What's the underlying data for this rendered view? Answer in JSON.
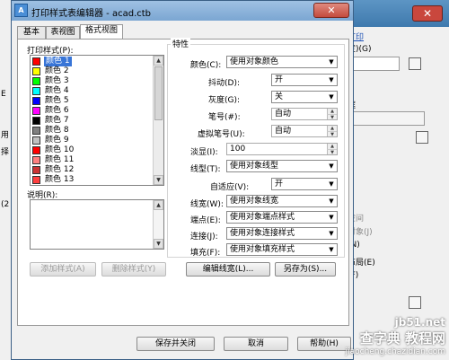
{
  "dialog": {
    "title": "打印样式表编辑器 - acad.ctb",
    "app_icon": "A",
    "close_glyph": "✕",
    "tabs": [
      {
        "label": "基本"
      },
      {
        "label": "表视图"
      },
      {
        "label": "格式视图"
      }
    ]
  },
  "styles": {
    "label": "打印样式(P):",
    "items": [
      {
        "label": "颜色 1",
        "color": "#ff0000",
        "selected": true
      },
      {
        "label": "颜色 2",
        "color": "#ffff00"
      },
      {
        "label": "颜色 3",
        "color": "#00ff00"
      },
      {
        "label": "颜色 4",
        "color": "#00ffff"
      },
      {
        "label": "颜色 5",
        "color": "#0000ff"
      },
      {
        "label": "颜色 6",
        "color": "#ff00ff"
      },
      {
        "label": "颜色 7",
        "color": "#000000"
      },
      {
        "label": "颜色 8",
        "color": "#808080"
      },
      {
        "label": "颜色 9",
        "color": "#c0c0c0"
      },
      {
        "label": "颜色 10",
        "color": "#ff0000"
      },
      {
        "label": "颜色 11",
        "color": "#ff7f7f"
      },
      {
        "label": "颜色 12",
        "color": "#cc3333"
      },
      {
        "label": "颜色 13",
        "color": "#ff3f3f"
      }
    ]
  },
  "description": {
    "label": "说明(R):"
  },
  "buttons": {
    "add_style": "添加样式(A)",
    "delete_style": "删除样式(Y)",
    "edit_lineweights": "编辑线宽(L)...",
    "save_as": "另存为(S)...",
    "save_close": "保存并关闭",
    "cancel": "取消",
    "help": "帮助(H)"
  },
  "properties": {
    "title": "特性",
    "color": {
      "label": "颜色(C):",
      "value": "使用对象颜色"
    },
    "dither": {
      "label": "抖动(D):",
      "value": "开"
    },
    "grayscale": {
      "label": "灰度(G):",
      "value": "关"
    },
    "pen": {
      "label": "笔号(#):",
      "value": "自动"
    },
    "virtual_pen": {
      "label": "虚拟笔号(U):",
      "value": "自动"
    },
    "screening": {
      "label": "淡显(I):",
      "value": "100"
    },
    "linetype": {
      "label": "线型(T):",
      "value": "使用对象线型"
    },
    "adaptive": {
      "label": "自适应(V):",
      "value": "开"
    },
    "lineweight": {
      "label": "线宽(W):",
      "value": "使用对象线宽"
    },
    "line_end": {
      "label": "端点(E):",
      "value": "使用对象端点样式"
    },
    "line_join": {
      "label": "连接(J):",
      "value": "使用对象连接样式"
    },
    "fill": {
      "label": "填充(F):",
      "value": "使用对象填充样式"
    }
  },
  "background": {
    "right_texts": [
      {
        "text": "打印",
        "style": "blue"
      },
      {
        "text": "定)(G)",
        "style": "normal"
      },
      {
        "text": "框",
        "style": "normal"
      },
      {
        "text": "空间",
        "style": "gray"
      },
      {
        "text": "对象(J)",
        "style": "gray"
      },
      {
        "text": "(N)",
        "style": "normal"
      },
      {
        "text": "布局(E)",
        "style": "normal"
      },
      {
        "text": "(F)",
        "style": "normal"
      }
    ],
    "left_texts": [
      "E",
      "用",
      "择",
      "(2"
    ],
    "close_glyph": "✕"
  },
  "watermark": {
    "line1": "jb51.net",
    "line2": "查字典 教程网",
    "line3": "jiaocheng.chazidian.com"
  }
}
